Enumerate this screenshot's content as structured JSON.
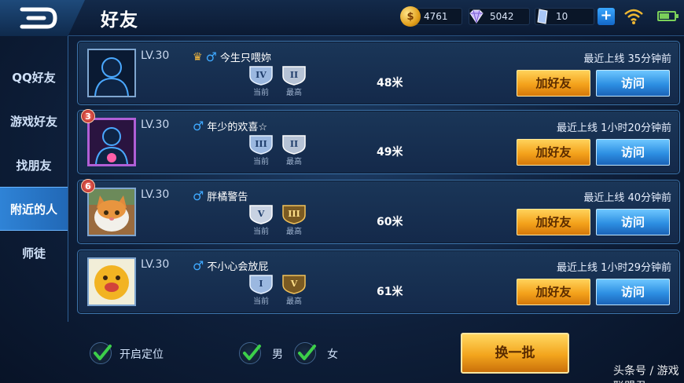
{
  "header": {
    "title": "好友",
    "gold": "4761",
    "diamond": "5042",
    "ticket": "10",
    "plus_label": "+"
  },
  "sidebar": {
    "items": [
      {
        "label": "QQ好友"
      },
      {
        "label": "游戏好友"
      },
      {
        "label": "找朋友"
      },
      {
        "label": "附近的人",
        "active": true
      },
      {
        "label": "师徒"
      }
    ]
  },
  "labels": {
    "current": "当前",
    "highest": "最高",
    "add_friend": "加好友",
    "visit": "访问"
  },
  "players": [
    {
      "level": "LV.30",
      "name": "今生只喂妳",
      "gender": "♂",
      "tier_current": "IV",
      "tier_highest": "II",
      "distance": "48米",
      "last_online": "最近上线  35分钟前",
      "rank_badge": ""
    },
    {
      "level": "LV.30",
      "name": "年少的欢喜☆",
      "gender": "♂",
      "tier_current": "III",
      "tier_highest": "II",
      "distance": "49米",
      "last_online": "最近上线  1小时20分钟前",
      "rank_badge": "3"
    },
    {
      "level": "LV.30",
      "name": "胖橘警告",
      "gender": "♂",
      "tier_current": "V",
      "tier_highest": "III",
      "distance": "60米",
      "last_online": "最近上线  40分钟前",
      "rank_badge": "6"
    },
    {
      "level": "LV.30",
      "name": "不小心会放屁",
      "gender": "♂",
      "tier_current": "I",
      "tier_highest": "V",
      "distance": "61米",
      "last_online": "最近上线  1小时29分钟前",
      "rank_badge": ""
    }
  ],
  "bottom": {
    "location_label": "开启定位",
    "male_label": "男",
    "female_label": "女",
    "refresh_label": "换一批",
    "watermark": "头条号 / 游戏联盟君"
  },
  "colors": {
    "accent_blue": "#2f83d6",
    "button_gold": "#f4a21b",
    "male_icon": "#3fa9ff",
    "check_green": "#3ccf4a"
  }
}
